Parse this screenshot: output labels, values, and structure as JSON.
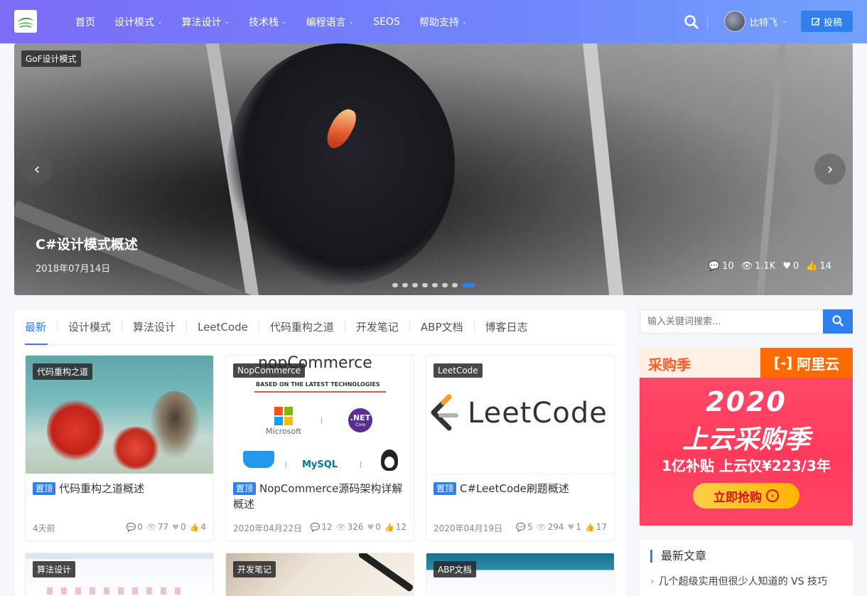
{
  "header": {
    "nav": [
      {
        "label": "首页",
        "dropdown": false
      },
      {
        "label": "设计模式",
        "dropdown": true
      },
      {
        "label": "算法设计",
        "dropdown": true
      },
      {
        "label": "技术栈",
        "dropdown": true
      },
      {
        "label": "编程语言",
        "dropdown": true
      },
      {
        "label": "SEOS",
        "dropdown": false
      },
      {
        "label": "帮助支持",
        "dropdown": true
      }
    ],
    "user_name": "比特飞",
    "submit_label": "投稿"
  },
  "slider": {
    "tag": "GoF设计模式",
    "title": "C#设计模式概述",
    "date": "2018年07月14日",
    "comments": "10",
    "views": "1.1K",
    "likes": "0",
    "thumbs": "14",
    "slide_count": 8,
    "active_slide": 8
  },
  "tabs": [
    "最新",
    "设计模式",
    "算法设计",
    "LeetCode",
    "代码重构之道",
    "开发笔记",
    "ABP文档",
    "博客日志"
  ],
  "cards": [
    {
      "category": "代码重构之道",
      "badge": "置顶",
      "title": "代码重构之道概述",
      "date": "4天前",
      "comments": "0",
      "views": "77",
      "likes": "0",
      "thumbs": "4"
    },
    {
      "category": "NopCommerce",
      "badge": "置顶",
      "title": "NopCommerce源码架构详解概述",
      "date": "2020年04月22日",
      "comments": "12",
      "views": "326",
      "likes": "0",
      "thumbs": "12",
      "image_text": {
        "brand": "nopCommerce",
        "tagline": "BASED ON THE LATEST TECHNOLOGIES",
        "ms": "Microsoft",
        "net": ".NET",
        "net_sub": "Core",
        "mysql": "MySQL"
      }
    },
    {
      "category": "LeetCode",
      "badge": "置顶",
      "title": "C#LeetCode刷题概述",
      "date": "2020年04月19日",
      "comments": "5",
      "views": "294",
      "likes": "1",
      "thumbs": "17",
      "image_text": {
        "brand": "LeetCode"
      }
    }
  ],
  "cards_row2": [
    {
      "category": "算法设计"
    },
    {
      "category": "开发笔记"
    },
    {
      "category": "ABP文档"
    }
  ],
  "sidebar": {
    "search_placeholder": "输入关键词搜索...",
    "ad": {
      "top_left": "采购季",
      "top_right": "阿里云",
      "year": "2020",
      "line1": "上云采购季",
      "line2": "1亿补贴 上云仅¥223/3年",
      "button": "立即抢购"
    },
    "recent_title": "最新文章",
    "recent_items": [
      "几个超级实用但很少人知道的 VS 技巧"
    ]
  },
  "colors": {
    "accent": "#2f80ed",
    "header_start": "#7c6cf6",
    "header_end": "#72a2fc"
  }
}
